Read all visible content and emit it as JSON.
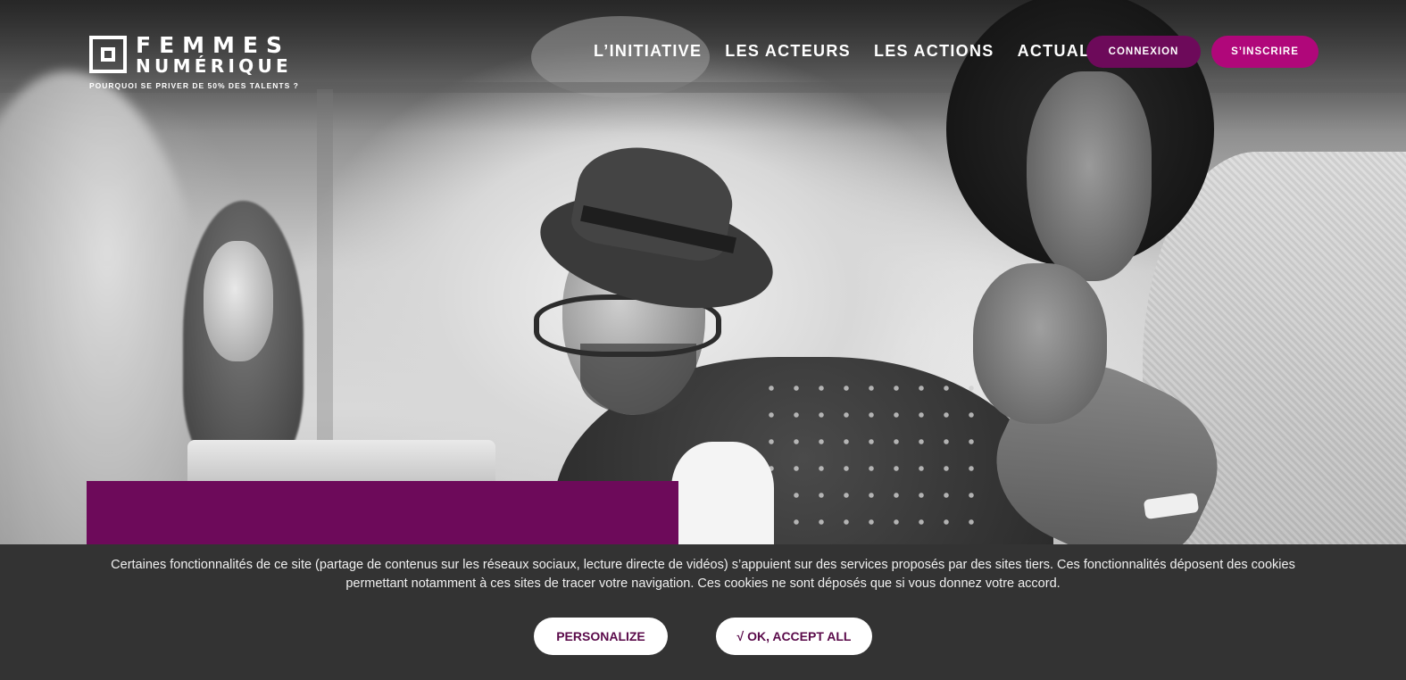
{
  "logo": {
    "line1": "FEMMES",
    "line2": "NUMÉRIQUE",
    "tagline": "POURQUOI SE PRIVER DE 50% DES TALENTS ?"
  },
  "nav": {
    "items": [
      {
        "label": "L’INITIATIVE"
      },
      {
        "label": "LES ACTEURS"
      },
      {
        "label": "LES ACTIONS"
      },
      {
        "label": "ACTUALITÉS"
      }
    ],
    "connexion_label": "CONNEXION",
    "signup_label": "S’INSCRIRE"
  },
  "cookie_banner": {
    "text": "Certaines fonctionnalités de ce site (partage de contenus sur les réseaux sociaux, lecture directe de vidéos) s’appuient sur des services proposés par des sites tiers. Ces fonctionnalités déposent des cookies permettant notamment à ces sites de tracer votre navigation. Ces cookies ne sont déposés que si vous donnez votre accord.",
    "personalize_label": "PERSONALIZE",
    "accept_label": "√ OK, ACCEPT ALL"
  },
  "colors": {
    "brand_dark_purple": "#6d0a5a",
    "brand_magenta": "#b0077a",
    "cookie_bar": "#333333"
  }
}
